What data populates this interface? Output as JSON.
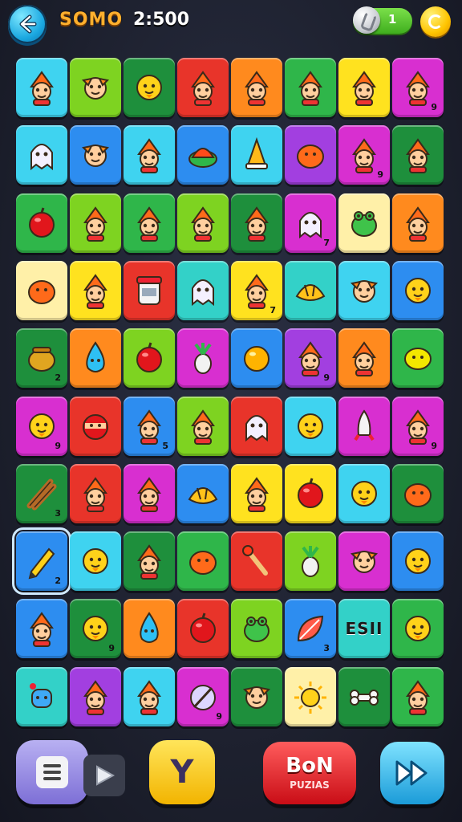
{
  "header": {
    "title": "SOMO",
    "score": "2:500",
    "toggle_value": "1",
    "back_icon": "back-arrow-icon",
    "coin_icon": "coin-icon"
  },
  "colors": {
    "red": "#e8342a",
    "orange": "#ff8a1e",
    "yellow": "#ffe21f",
    "green": "#2fb64a",
    "lime": "#7ed321",
    "teal": "#33d1c8",
    "blue": "#2d8df0",
    "purple": "#a23fe0",
    "magenta": "#d82fd0",
    "deep_green": "#1e8f3c",
    "cyan": "#3fd3f0",
    "cream": "#fff0a8"
  },
  "grid": {
    "rows": 10,
    "cols": 8,
    "tiles": [
      [
        {
          "color": "cyan",
          "icon": "gnome-icon",
          "count": ""
        },
        {
          "color": "lime",
          "icon": "bird-icon",
          "count": ""
        },
        {
          "color": "deep_green",
          "icon": "chick-icon",
          "count": ""
        },
        {
          "color": "red",
          "icon": "gnome-icon",
          "count": ""
        },
        {
          "color": "orange",
          "icon": "gnome-icon",
          "count": ""
        },
        {
          "color": "green",
          "icon": "gnome-icon",
          "count": ""
        },
        {
          "color": "yellow",
          "icon": "gnome-icon",
          "count": ""
        },
        {
          "color": "magenta",
          "icon": "gnome-icon",
          "count": "9"
        }
      ],
      [
        {
          "color": "cyan",
          "icon": "ghost-icon",
          "count": ""
        },
        {
          "color": "blue",
          "icon": "bird-icon",
          "count": ""
        },
        {
          "color": "cyan",
          "icon": "gnome-icon",
          "count": ""
        },
        {
          "color": "blue",
          "icon": "turtle-icon",
          "count": ""
        },
        {
          "color": "cyan",
          "icon": "cone-icon",
          "count": ""
        },
        {
          "color": "purple",
          "icon": "blob-icon",
          "count": ""
        },
        {
          "color": "magenta",
          "icon": "gnome-icon",
          "count": "9"
        },
        {
          "color": "deep_green",
          "icon": "gnome-icon",
          "count": ""
        }
      ],
      [
        {
          "color": "green",
          "icon": "apple-icon",
          "count": ""
        },
        {
          "color": "lime",
          "icon": "gnome-icon",
          "count": ""
        },
        {
          "color": "green",
          "icon": "gnome-icon",
          "count": ""
        },
        {
          "color": "lime",
          "icon": "gnome-icon",
          "count": ""
        },
        {
          "color": "deep_green",
          "icon": "gnome-icon",
          "count": ""
        },
        {
          "color": "magenta",
          "icon": "ghost-icon",
          "count": "7"
        },
        {
          "color": "cream",
          "icon": "frog-icon",
          "count": ""
        },
        {
          "color": "orange",
          "icon": "gnome-icon",
          "count": ""
        }
      ],
      [
        {
          "color": "cream",
          "icon": "blob-icon",
          "count": ""
        },
        {
          "color": "yellow",
          "icon": "gnome-icon",
          "count": ""
        },
        {
          "color": "red",
          "icon": "jar-icon",
          "count": ""
        },
        {
          "color": "teal",
          "icon": "ghost-icon",
          "count": ""
        },
        {
          "color": "yellow",
          "icon": "gnome-icon",
          "count": "7"
        },
        {
          "color": "teal",
          "icon": "croissant-icon",
          "count": ""
        },
        {
          "color": "cyan",
          "icon": "bird-icon",
          "count": ""
        },
        {
          "color": "blue",
          "icon": "chick-icon",
          "count": ""
        }
      ],
      [
        {
          "color": "deep_green",
          "icon": "pot-icon",
          "count": "2"
        },
        {
          "color": "orange",
          "icon": "drop-icon",
          "count": ""
        },
        {
          "color": "lime",
          "icon": "apple-icon",
          "count": ""
        },
        {
          "color": "magenta",
          "icon": "radish-icon",
          "count": ""
        },
        {
          "color": "blue",
          "icon": "orange-icon",
          "count": ""
        },
        {
          "color": "purple",
          "icon": "gnome-icon",
          "count": "9"
        },
        {
          "color": "orange",
          "icon": "gnome-icon",
          "count": ""
        },
        {
          "color": "green",
          "icon": "lemon-icon",
          "count": ""
        }
      ],
      [
        {
          "color": "magenta",
          "icon": "chick-icon",
          "count": "9"
        },
        {
          "color": "red",
          "icon": "ninja-icon",
          "count": ""
        },
        {
          "color": "blue",
          "icon": "gnome-icon",
          "count": "5"
        },
        {
          "color": "lime",
          "icon": "gnome-icon",
          "count": ""
        },
        {
          "color": "red",
          "icon": "ghost-icon",
          "count": ""
        },
        {
          "color": "cyan",
          "icon": "chick-icon",
          "count": ""
        },
        {
          "color": "magenta",
          "icon": "rocket-icon",
          "count": ""
        },
        {
          "color": "magenta",
          "icon": "gnome-icon",
          "count": "9"
        }
      ],
      [
        {
          "color": "deep_green",
          "icon": "sticks-icon",
          "count": "3"
        },
        {
          "color": "red",
          "icon": "gnome-icon",
          "count": ""
        },
        {
          "color": "magenta",
          "icon": "gnome-icon",
          "count": ""
        },
        {
          "color": "blue",
          "icon": "croissant-icon",
          "count": ""
        },
        {
          "color": "yellow",
          "icon": "gnome-icon",
          "count": ""
        },
        {
          "color": "yellow",
          "icon": "apple-icon",
          "count": ""
        },
        {
          "color": "cyan",
          "icon": "chick-icon",
          "count": ""
        },
        {
          "color": "deep_green",
          "icon": "blob-icon",
          "count": ""
        }
      ],
      [
        {
          "color": "blue",
          "icon": "pencil-icon",
          "count": "2",
          "selected": true
        },
        {
          "color": "cyan",
          "icon": "chick-icon",
          "count": ""
        },
        {
          "color": "deep_green",
          "icon": "gnome-icon",
          "count": ""
        },
        {
          "color": "green",
          "icon": "blob-icon",
          "count": ""
        },
        {
          "color": "red",
          "icon": "brush-icon",
          "count": ""
        },
        {
          "color": "lime",
          "icon": "radish-icon",
          "count": ""
        },
        {
          "color": "magenta",
          "icon": "bird-icon",
          "count": ""
        },
        {
          "color": "blue",
          "icon": "chick-icon",
          "count": ""
        }
      ],
      [
        {
          "color": "blue",
          "icon": "gnome-icon",
          "count": ""
        },
        {
          "color": "deep_green",
          "icon": "chick-icon",
          "count": "9"
        },
        {
          "color": "orange",
          "icon": "drop-icon",
          "count": ""
        },
        {
          "color": "red",
          "icon": "apple-icon",
          "count": ""
        },
        {
          "color": "lime",
          "icon": "frog-icon",
          "count": ""
        },
        {
          "color": "blue",
          "icon": "leaf-icon",
          "count": "3"
        },
        {
          "color": "teal",
          "label": "ESII",
          "count": ""
        },
        {
          "color": "green",
          "icon": "chick-icon",
          "count": ""
        }
      ],
      [
        {
          "color": "teal",
          "icon": "robot-icon",
          "count": ""
        },
        {
          "color": "purple",
          "icon": "gnome-icon",
          "count": ""
        },
        {
          "color": "cyan",
          "icon": "gnome-icon",
          "count": ""
        },
        {
          "color": "magenta",
          "icon": "ball-icon",
          "count": "9"
        },
        {
          "color": "deep_green",
          "icon": "bird-icon",
          "count": ""
        },
        {
          "color": "cream",
          "icon": "sun-icon",
          "count": ""
        },
        {
          "color": "deep_green",
          "icon": "bone-icon",
          "count": ""
        },
        {
          "color": "green",
          "icon": "gnome-icon",
          "count": ""
        }
      ]
    ]
  },
  "bottom_bar": {
    "menu_icon": "document-icon",
    "y_label": "Y",
    "bon_label": "BoN",
    "bon_sub": "PUZIAS",
    "ff_icon": "fast-forward-icon"
  }
}
